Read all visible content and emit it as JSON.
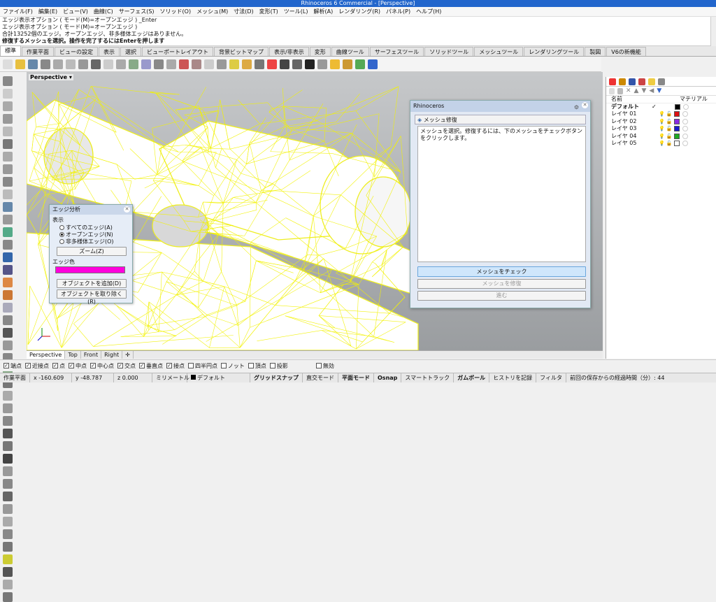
{
  "window": {
    "title": "Rhinoceros 6 Commercial - [Perspective]"
  },
  "menu": [
    "ファイル(F)",
    "編集(E)",
    "ビュー(V)",
    "曲線(C)",
    "サーフェス(S)",
    "ソリッド(O)",
    "メッシュ(M)",
    "寸法(D)",
    "変形(T)",
    "ツール(L)",
    "解析(A)",
    "レンダリング(R)",
    "パネル(P)",
    "ヘルプ(H)"
  ],
  "command": {
    "history": [
      "エッジ表示オプション ( モード(M)=オープンエッジ ) _Enter",
      "エッジ表示オプション ( モード(M)=オープンエッジ )",
      "合計13252個のエッジ。オープンエッジ、非多様体エッジはありません。"
    ],
    "prompt": "修復するメッシュを選択。操作を完了するにはEnterを押します"
  },
  "tabs": [
    "標準",
    "作業平面",
    "ビューの設定",
    "表示",
    "選択",
    "ビューポートレイアウト",
    "背景ビットマップ",
    "表示/非表示",
    "変形",
    "曲線ツール",
    "サーフェスツール",
    "ソリッドツール",
    "メッシュツール",
    "レンダリングツール",
    "製図",
    "V6の新機能"
  ],
  "viewport": {
    "name": "Perspective",
    "tabs": [
      "Perspective",
      "Top",
      "Front",
      "Right"
    ],
    "add_tab": "✛"
  },
  "edge_dialog": {
    "title": "エッジ分析",
    "group_label": "表示",
    "options": [
      "すべてのエッジ(A)",
      "オープンエッジ(N)",
      "非多様体エッジ(O)"
    ],
    "selected_index": 1,
    "zoom_button": "ズーム(Z)",
    "color_label": "エッジ色",
    "edge_color": "#ff00dd",
    "add_button": "オブジェクトを追加(D)",
    "remove_button": "オブジェクトを取り除く(R)"
  },
  "mesh_dialog": {
    "title": "Rhinoceros",
    "panel_title": "メッシュ修復",
    "instructions": "メッシュを選択。修復するには、下のメッシュをチェックボタンをクリックします。",
    "check_button": "メッシュをチェック",
    "repair_button": "メッシュを修復",
    "next_button": "進む"
  },
  "layers": {
    "headers": {
      "name": "名前",
      "material": "マテリアル"
    },
    "rows": [
      {
        "name": "デフォルト",
        "current": true,
        "color": "#000000"
      },
      {
        "name": "レイヤ 01",
        "current": false,
        "color": "#dd1111"
      },
      {
        "name": "レイヤ 02",
        "current": false,
        "color": "#8a2be2"
      },
      {
        "name": "レイヤ 03",
        "current": false,
        "color": "#1a1acc"
      },
      {
        "name": "レイヤ 04",
        "current": false,
        "color": "#22aa22"
      },
      {
        "name": "レイヤ 05",
        "current": false,
        "color": "#ffffff"
      }
    ]
  },
  "osnaps": [
    {
      "label": "端点",
      "checked": true
    },
    {
      "label": "近接点",
      "checked": true
    },
    {
      "label": "点",
      "checked": true
    },
    {
      "label": "中点",
      "checked": true
    },
    {
      "label": "中心点",
      "checked": true
    },
    {
      "label": "交点",
      "checked": true
    },
    {
      "label": "垂直点",
      "checked": true
    },
    {
      "label": "接点",
      "checked": true
    },
    {
      "label": "四半円点",
      "checked": false
    },
    {
      "label": "ノット",
      "checked": false
    },
    {
      "label": "頂点",
      "checked": false
    },
    {
      "label": "投影",
      "checked": false
    }
  ],
  "disable_osnap": "無効",
  "status": {
    "cplane": "作業平面",
    "x": "x -160.609",
    "y": "y -48.787",
    "z": "z 0.000",
    "units": "ミリメートル",
    "layer": "デフォルト",
    "grid_snap": "グリッドスナップ",
    "ortho": "直交モード",
    "planar": "平面モード",
    "osnap": "Osnap",
    "smarttrack": "スマートトラック",
    "gumball": "ガムボール",
    "history": "ヒストリを記録",
    "filter": "フィルタ",
    "saved": "前回の保存からの経過時間（分）: 44"
  }
}
